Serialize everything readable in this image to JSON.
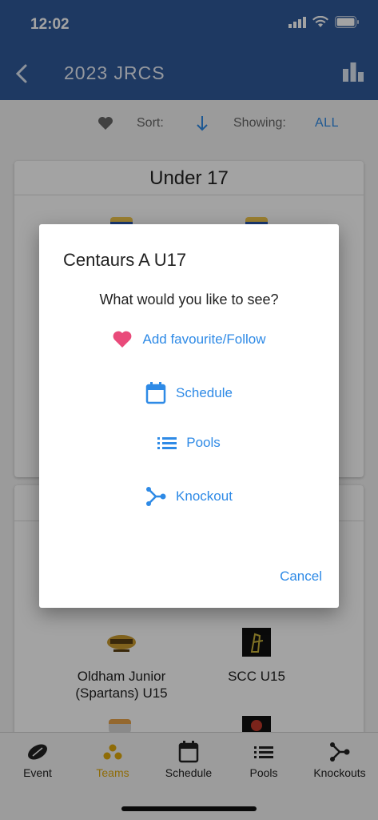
{
  "status": {
    "time": "12:02"
  },
  "appbar": {
    "title": "2023 JRCS"
  },
  "filter": {
    "sort_label": "Sort:",
    "showing_label": "Showing:",
    "showing_value": "ALL"
  },
  "card1": {
    "title": "Under 17"
  },
  "card2": {
    "teams": [
      {
        "name_line1": "Oldham Junior",
        "name_line2": "(Spartans) U15"
      },
      {
        "name_line1": "SCC U15",
        "name_line2": ""
      }
    ]
  },
  "dialog": {
    "title": "Centaurs A U17",
    "question": "What would you like to see?",
    "options": [
      {
        "label": "Add favourite/Follow",
        "icon": "heart-icon"
      },
      {
        "label": "Schedule",
        "icon": "calendar-icon"
      },
      {
        "label": "Pools",
        "icon": "list-icon"
      },
      {
        "label": "Knockout",
        "icon": "bracket-icon"
      }
    ],
    "cancel": "Cancel"
  },
  "nav": [
    {
      "label": "Event",
      "icon": "rugby-ball-icon"
    },
    {
      "label": "Teams",
      "icon": "teams-icon"
    },
    {
      "label": "Schedule",
      "icon": "calendar-icon"
    },
    {
      "label": "Pools",
      "icon": "list-icon"
    },
    {
      "label": "Knockouts",
      "icon": "bracket-icon"
    }
  ],
  "colors": {
    "appbar": "#2f5a9a",
    "accent": "#2e8ae6",
    "heart": "#e94a7a",
    "active_tab": "#e0a90c"
  }
}
